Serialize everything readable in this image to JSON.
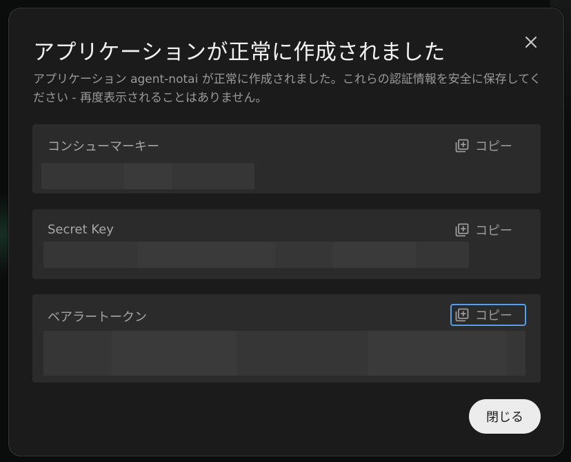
{
  "dialog": {
    "title": "アプリケーションが正常に作成されました",
    "description": "アプリケーション agent-notai が正常に作成されました。これらの認証情報を安全に保存してください - 再度表示されることはありません。",
    "close_label": "閉じる"
  },
  "fields": [
    {
      "label": "コンシューマーキー",
      "copy_label": "コピー"
    },
    {
      "label": "Secret Key",
      "copy_label": "コピー"
    },
    {
      "label": "ベアラートークン",
      "copy_label": "コピー"
    }
  ],
  "icons": {
    "close": "close-icon",
    "copy": "copy-icon"
  },
  "colors": {
    "focus_ring": "#5aa0e6",
    "modal_bg": "#1b1b1b",
    "field_bg": "#2b2b2b"
  }
}
